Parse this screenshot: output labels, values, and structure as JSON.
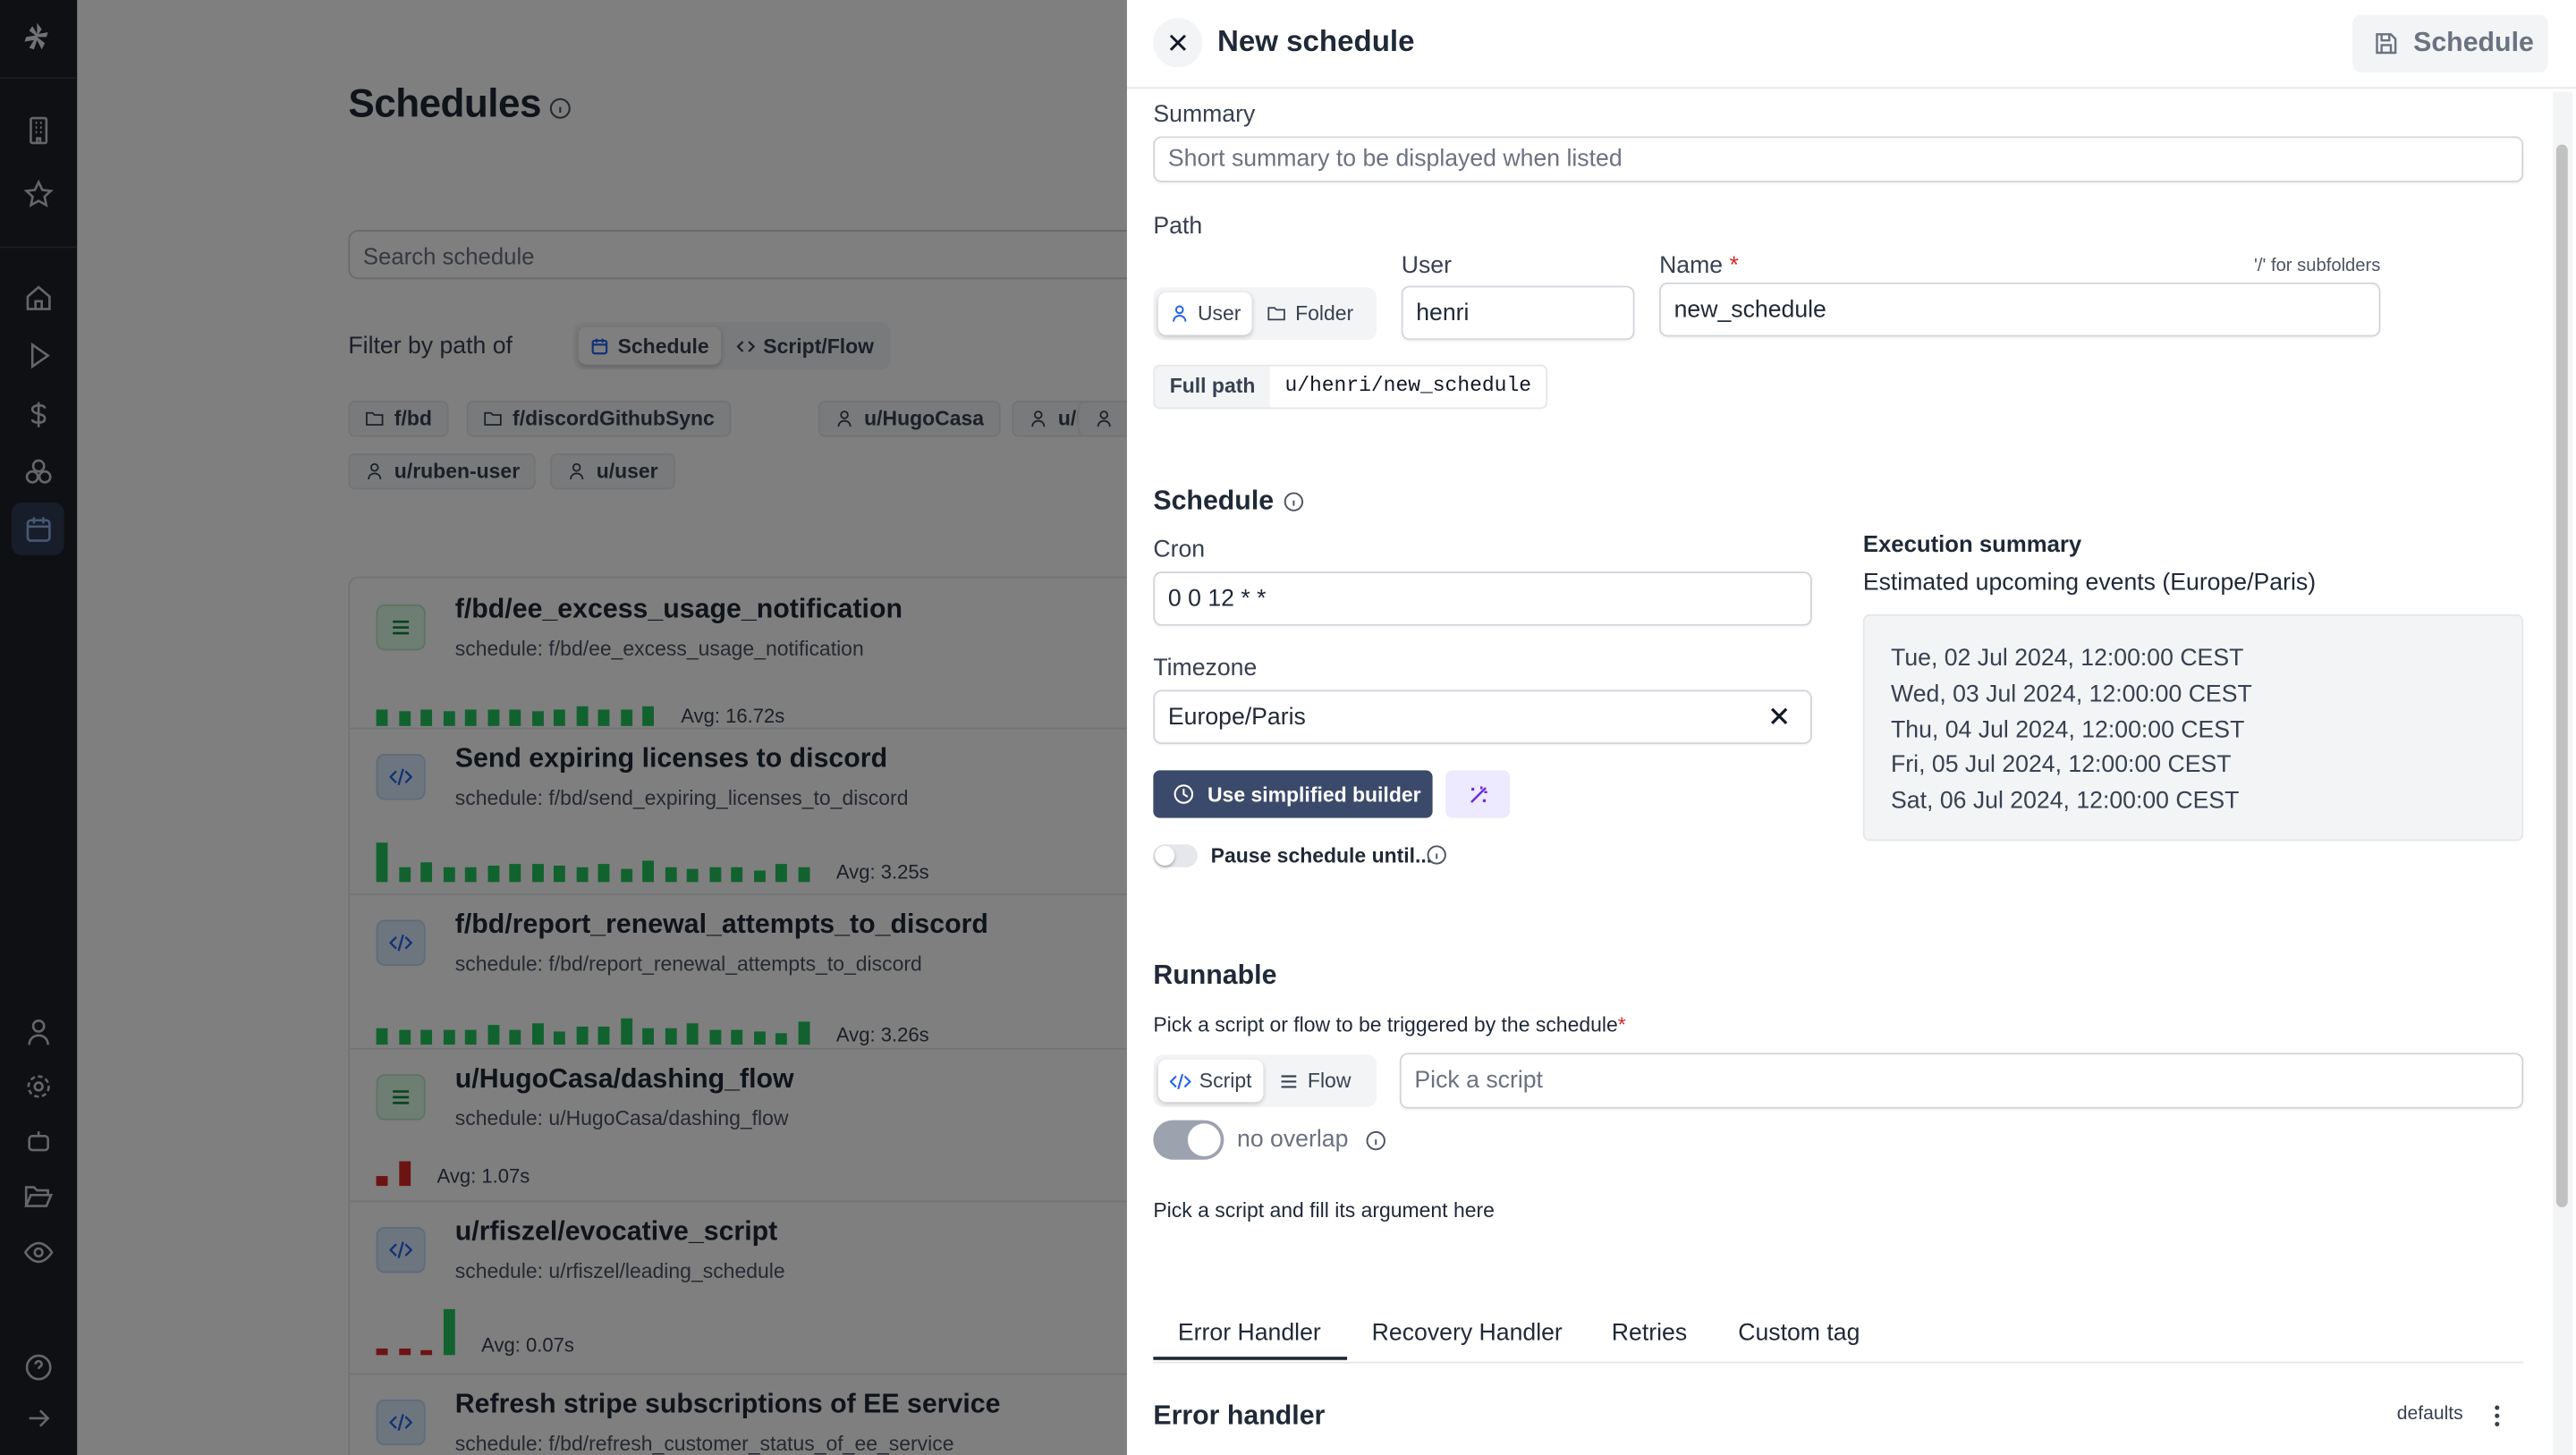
{
  "sidebar": {
    "items": [
      "logo",
      "workspaces",
      "favorites",
      "home",
      "runs",
      "billing",
      "resources",
      "schedules",
      "user",
      "settings",
      "bot",
      "folders",
      "eye",
      "help",
      "collapse"
    ],
    "selected": "schedules"
  },
  "page": {
    "title": "Schedules",
    "search_placeholder": "Search schedule",
    "filter_label": "Filter by path of",
    "filter_options": [
      "Schedule",
      "Script/Flow"
    ],
    "filter_selected": "Schedule",
    "chips": [
      {
        "kind": "folder",
        "label": "f/bd"
      },
      {
        "kind": "folder",
        "label": "f/discordGithubSync"
      },
      {
        "kind": "user",
        "label": "u/HugoCasa"
      },
      {
        "kind": "user",
        "label": "u/Ross"
      },
      {
        "kind": "user",
        "label": ""
      },
      {
        "kind": "user",
        "label": "u/ruben-user"
      },
      {
        "kind": "user",
        "label": "u/user"
      }
    ],
    "items": [
      {
        "kind": "flow",
        "title": "f/bd/ee_excess_usage_notification",
        "subtitle": "schedule: f/bd/ee_excess_usage_notification",
        "avg": "Avg: 16.72s",
        "bars": [
          [
            "ok",
            1
          ],
          [
            "ok",
            0.9
          ],
          [
            "ok",
            1
          ],
          [
            "ok",
            0.9
          ],
          [
            "ok",
            1
          ],
          [
            "ok",
            1
          ],
          [
            "ok",
            1
          ],
          [
            "ok",
            0.9
          ],
          [
            "ok",
            1
          ],
          [
            "ok",
            1.2
          ],
          [
            "ok",
            1
          ],
          [
            "ok",
            1
          ],
          [
            "ok",
            1.2
          ]
        ]
      },
      {
        "kind": "script",
        "title": "Send expiring licenses to discord",
        "subtitle": "schedule: f/bd/send_expiring_licenses_to_discord",
        "avg": "Avg: 3.25s",
        "bars": [
          [
            "ok",
            2.4
          ],
          [
            "ok",
            0.9
          ],
          [
            "ok",
            1.2
          ],
          [
            "ok",
            0.9
          ],
          [
            "ok",
            0.9
          ],
          [
            "ok",
            1
          ],
          [
            "ok",
            1.1
          ],
          [
            "ok",
            1.1
          ],
          [
            "ok",
            1
          ],
          [
            "ok",
            0.9
          ],
          [
            "ok",
            1.1
          ],
          [
            "ok",
            0.8
          ],
          [
            "ok",
            1.3
          ],
          [
            "ok",
            0.9
          ],
          [
            "ok",
            0.8
          ],
          [
            "ok",
            0.9
          ],
          [
            "ok",
            0.9
          ],
          [
            "ok",
            0.7
          ],
          [
            "ok",
            1.1
          ],
          [
            "ok",
            0.9
          ]
        ]
      },
      {
        "kind": "script",
        "title": "f/bd/report_renewal_attempts_to_discord",
        "subtitle": "schedule: f/bd/report_renewal_attempts_to_discord",
        "avg": "Avg: 3.26s",
        "bars": [
          [
            "ok",
            1
          ],
          [
            "ok",
            0.9
          ],
          [
            "ok",
            0.9
          ],
          [
            "ok",
            0.9
          ],
          [
            "ok",
            0.9
          ],
          [
            "ok",
            1.2
          ],
          [
            "ok",
            0.9
          ],
          [
            "ok",
            1.3
          ],
          [
            "ok",
            0.8
          ],
          [
            "ok",
            1.1
          ],
          [
            "ok",
            1.1
          ],
          [
            "ok",
            1.6
          ],
          [
            "ok",
            1
          ],
          [
            "ok",
            1
          ],
          [
            "ok",
            1.3
          ],
          [
            "ok",
            0.9
          ],
          [
            "ok",
            0.9
          ],
          [
            "ok",
            0.8
          ],
          [
            "ok",
            0.7
          ],
          [
            "ok",
            1.4
          ]
        ]
      },
      {
        "kind": "flow",
        "title": "u/HugoCasa/dashing_flow",
        "subtitle": "schedule: u/HugoCasa/dashing_flow",
        "avg": "Avg: 1.07s",
        "bars": [
          [
            "fail",
            0.6
          ],
          [
            "fail",
            1.5
          ]
        ]
      },
      {
        "kind": "script",
        "title": "u/rfiszel/evocative_script",
        "subtitle": "schedule: u/rfiszel/leading_schedule",
        "avg": "Avg: 0.07s",
        "bars": [
          [
            "fail",
            0.4
          ],
          [
            "fail",
            0.4
          ],
          [
            "fail",
            0.3
          ],
          [
            "ok",
            2.8
          ]
        ]
      },
      {
        "kind": "script",
        "title": "Refresh stripe subscriptions of EE service",
        "subtitle": "schedule: f/bd/refresh_customer_status_of_ee_service",
        "avg": "",
        "bars": []
      }
    ]
  },
  "drawer": {
    "title": "New schedule",
    "save_label": "Schedule",
    "summary_label": "Summary",
    "summary_placeholder": "Short summary to be displayed when listed",
    "path_label": "Path",
    "owner_options": [
      "User",
      "Folder"
    ],
    "owner_selected": "User",
    "user_label": "User",
    "user_value": "henri",
    "name_label": "Name",
    "required_mark": "*",
    "subfolder_hint": "'/' for subfolders",
    "name_value": "new_schedule",
    "full_path_label": "Full path",
    "full_path_value": "u/henri/new_schedule",
    "schedule_heading": "Schedule",
    "cron_label": "Cron",
    "cron_value": "0 0 12 * *",
    "timezone_label": "Timezone",
    "timezone_value": "Europe/Paris",
    "simplified_builder_label": "Use simplified builder",
    "pause_label": "Pause schedule until...",
    "pause_enabled": false,
    "execution_summary_title": "Execution summary",
    "execution_summary_subtitle": "Estimated upcoming events (Europe/Paris)",
    "upcoming_events": [
      "Tue, 02 Jul 2024, 12:00:00 CEST",
      "Wed, 03 Jul 2024, 12:00:00 CEST",
      "Thu, 04 Jul 2024, 12:00:00 CEST",
      "Fri, 05 Jul 2024, 12:00:00 CEST",
      "Sat, 06 Jul 2024, 12:00:00 CEST"
    ],
    "runnable_heading": "Runnable",
    "runnable_desc": "Pick a script or flow to be triggered by the schedule",
    "runnable_options": [
      "Script",
      "Flow"
    ],
    "runnable_selected": "Script",
    "script_placeholder": "Pick a script",
    "no_overlap_label": "no overlap",
    "no_overlap_enabled": true,
    "args_hint": "Pick a script and fill its argument here",
    "tabs": [
      "Error Handler",
      "Recovery Handler",
      "Retries",
      "Custom tag"
    ],
    "tab_selected": "Error Handler",
    "error_handler_heading": "Error handler",
    "defaults_label": "defaults"
  },
  "colors": {
    "accent": "#3b4a6b",
    "success": "#22c55e",
    "failure": "#dc2626",
    "required": "#dc2626",
    "wand_bg": "#ede9fe",
    "wand": "#6d28d9"
  }
}
